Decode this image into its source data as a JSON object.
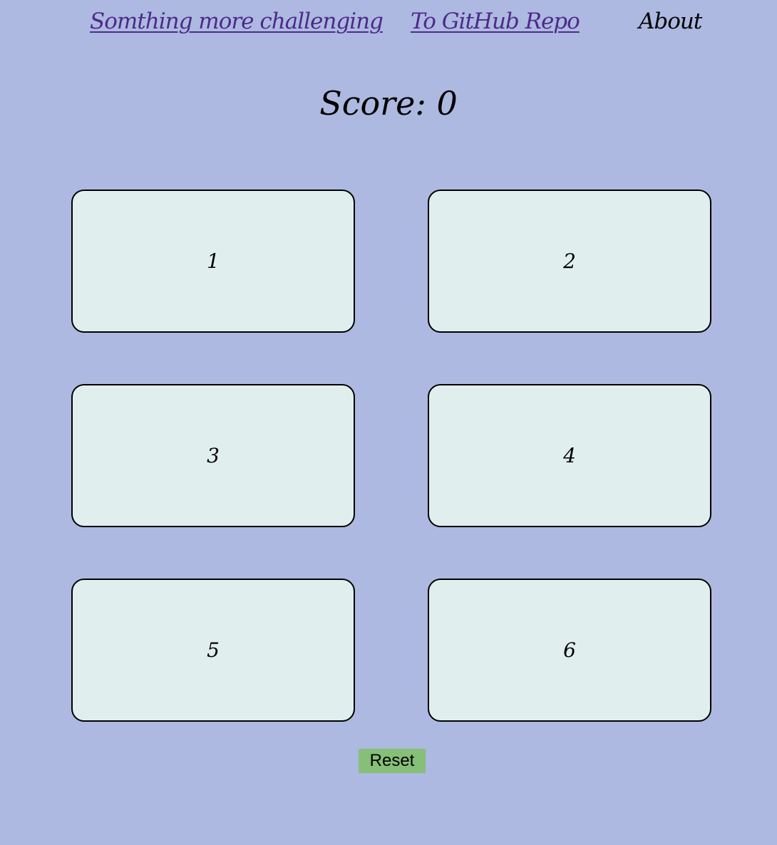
{
  "nav": {
    "challenge_link": "Somthing more challenging",
    "github_link": "To GitHub Repo",
    "about": "About"
  },
  "score": {
    "text": "Score: 0"
  },
  "cards": [
    {
      "label": "1"
    },
    {
      "label": "2"
    },
    {
      "label": "3"
    },
    {
      "label": "4"
    },
    {
      "label": "5"
    },
    {
      "label": "6"
    }
  ],
  "reset": {
    "label": "Reset"
  },
  "colors": {
    "background": "#adb9e0",
    "card": "#e0eeee",
    "link": "#4d2a8b",
    "reset_button": "#86bf78"
  }
}
